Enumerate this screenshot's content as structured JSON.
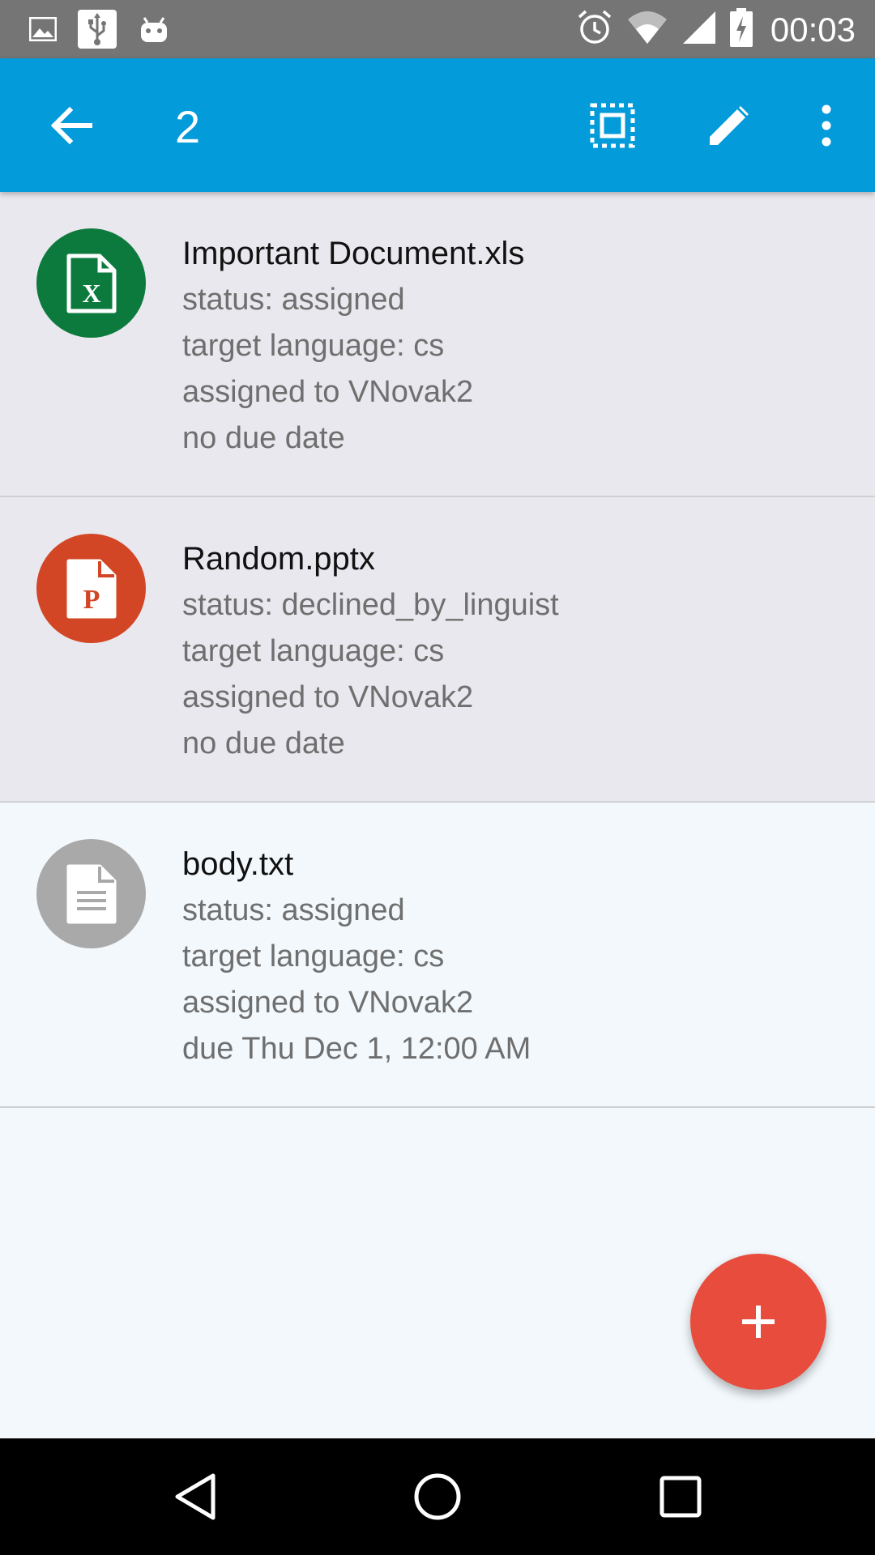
{
  "status_bar": {
    "time": "00:03",
    "icons": [
      "image-icon",
      "usb-icon",
      "android-icon",
      "alarm-icon",
      "wifi-icon",
      "signal-icon",
      "battery-charging-icon"
    ]
  },
  "app_bar": {
    "selected_count": "2",
    "icons": [
      "back-arrow-icon",
      "select-all-icon",
      "edit-icon",
      "more-vert-icon"
    ],
    "color": "#049bda"
  },
  "items": [
    {
      "title": "Important Document.xls",
      "status": "status: assigned",
      "target": "target language: cs",
      "assignee": "assigned to VNovak2",
      "due": "no due date",
      "icon": "excel-file-icon",
      "icon_color": "#0c7a3d",
      "selected": true
    },
    {
      "title": "Random.pptx",
      "status": "status: declined_by_linguist",
      "target": "target language: cs",
      "assignee": "assigned to VNovak2",
      "due": "no due date",
      "icon": "powerpoint-file-icon",
      "icon_color": "#d24625",
      "selected": true
    },
    {
      "title": "body.txt",
      "status": "status: assigned",
      "target": "target language: cs",
      "assignee": "assigned to VNovak2",
      "due": "due Thu Dec 1, 12:00 AM",
      "icon": "text-file-icon",
      "icon_color": "#a9a9a9",
      "selected": false
    }
  ],
  "fab": {
    "icon": "plus-icon",
    "color": "#e74c3c"
  },
  "nav_bar": {
    "icons": [
      "back-triangle-icon",
      "home-circle-icon",
      "recents-square-icon"
    ]
  }
}
